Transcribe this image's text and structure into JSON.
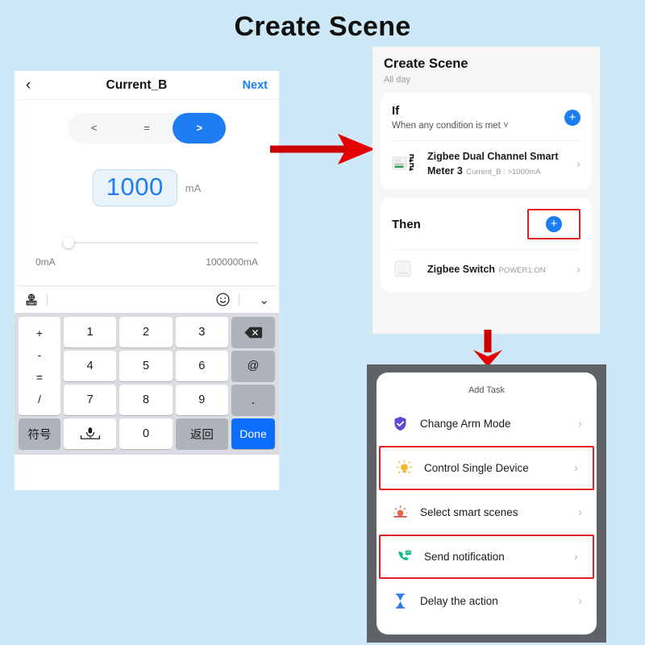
{
  "title": "Create Scene",
  "colors": {
    "background": "#cfe8f7",
    "accent_blue": "#1f7df4",
    "highlight_red": "#e02020",
    "panel_frame_gray": "#5f6368"
  },
  "left_phone": {
    "nav": {
      "back_icon": "chevron-left-icon",
      "title": "Current_B",
      "next_label": "Next"
    },
    "comparator": {
      "options": [
        "<",
        "=",
        ">"
      ],
      "selected": ">"
    },
    "value": {
      "amount": "1000",
      "unit": "mA"
    },
    "slider": {
      "min_label": "0mA",
      "max_label": "1000000mA",
      "position_percent": 7
    },
    "ime_bar": {
      "globe_icon": "globe-keyboard-icon",
      "emoji_icon": "emoji-smiley-icon",
      "collapse_icon": "chevron-down-icon"
    },
    "keyboard": {
      "operators": [
        "+",
        "-",
        "=",
        "/"
      ],
      "digits_row1": [
        "1",
        "2",
        "3"
      ],
      "digits_row2": [
        "4",
        "5",
        "6"
      ],
      "digits_row3": [
        "7",
        "8",
        "9"
      ],
      "backspace_icon": "backspace-icon",
      "at_label": "@",
      "dot_label": ".",
      "symbols_label": "符号",
      "space_icon": "space-mic-icon",
      "zero_label": "0",
      "return_label": "返回",
      "done_label": "Done"
    }
  },
  "scene_panel": {
    "title": "Create Scene",
    "subtitle": "All day",
    "if_card": {
      "title": "If",
      "subtitle": "When any condition is met ˅",
      "add_icon": "plus-circle-icon",
      "device": {
        "icon": "zigbee-meter-icon",
        "name": "Zigbee Dual Channel Smart Meter 3",
        "meta": "Current_B : >1000mA",
        "chevron": "chevron-right-icon"
      }
    },
    "then_card": {
      "title": "Then",
      "add_icon": "plus-circle-icon",
      "highlighted": true,
      "device": {
        "icon": "zigbee-switch-icon",
        "name": "Zigbee Switch",
        "meta": "POWER1:ON",
        "chevron": "chevron-right-icon"
      }
    }
  },
  "add_task_sheet": {
    "title": "Add Task",
    "items": [
      {
        "label": "Change Arm Mode",
        "icon": "shield-check-icon",
        "icon_color": "#5b4bd6",
        "highlighted": false
      },
      {
        "label": "Control Single Device",
        "icon": "lightbulb-icon",
        "icon_color": "#f5a623",
        "highlighted": true
      },
      {
        "label": "Select smart scenes",
        "icon": "scene-sunrise-icon",
        "icon_color": "#e8674c",
        "highlighted": false
      },
      {
        "label": "Send notification",
        "icon": "phone-message-icon",
        "icon_color": "#12b886",
        "highlighted": false
      },
      {
        "label": "Delay the action",
        "icon": "hourglass-icon",
        "icon_color": "#2f7bea",
        "highlighted": true
      }
    ]
  },
  "arrows": [
    {
      "name": "arrow-left-to-scene",
      "direction": "right",
      "color": "#cc0000"
    },
    {
      "name": "arrow-scene-to-tasks",
      "direction": "down",
      "color": "#cc0000"
    }
  ]
}
